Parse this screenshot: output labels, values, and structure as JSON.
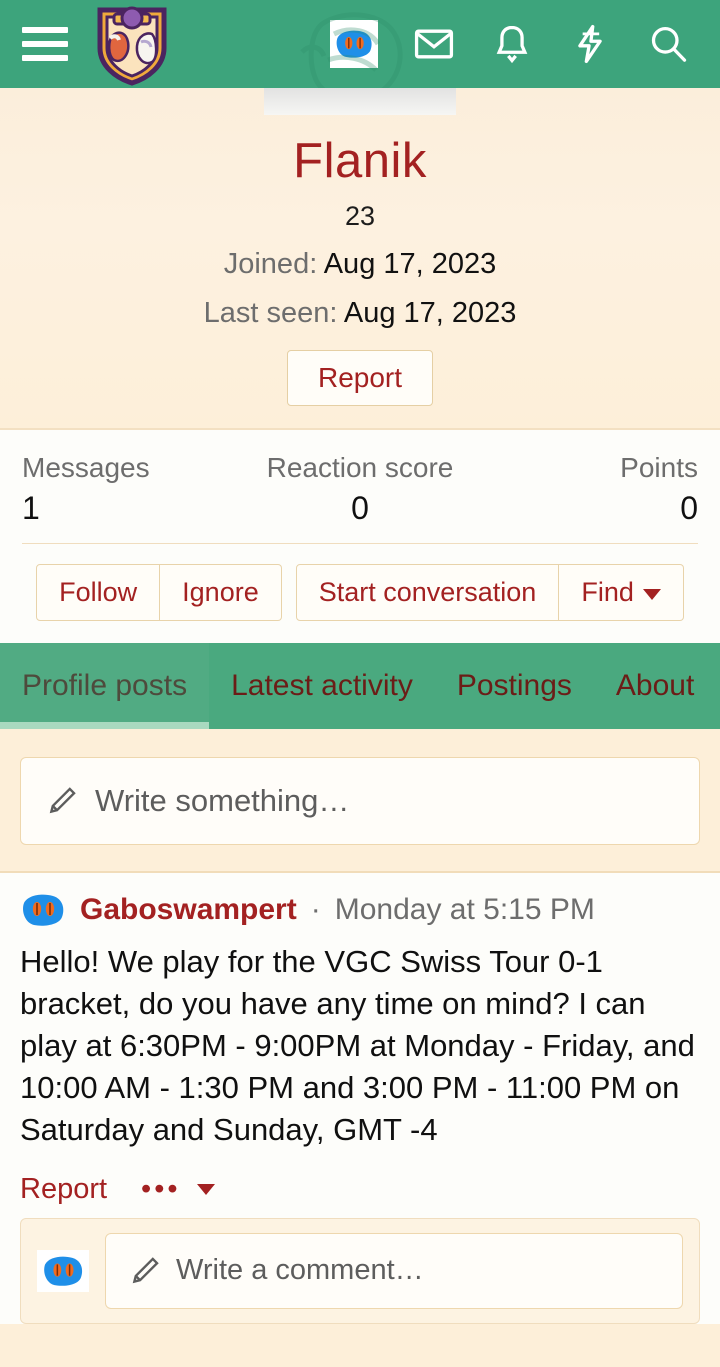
{
  "header": {
    "menu_icon": "hamburger-menu-icon",
    "logo_icon": "site-logo-crest-icon",
    "avatar_icon": "user-avatar-icon",
    "inbox_icon": "envelope-icon",
    "alerts_icon": "bell-icon",
    "whats_new_icon": "lightning-bolt-icon",
    "search_icon": "magnifier-icon",
    "brand_color": "#3da47c"
  },
  "profile": {
    "username": "Flanik",
    "user_title": "23",
    "joined_label": "Joined:",
    "joined_value": "Aug 17, 2023",
    "last_seen_label": "Last seen:",
    "last_seen_value": "Aug 17, 2023",
    "report_label": "Report",
    "username_color": "#a32121"
  },
  "stats": [
    {
      "label": "Messages",
      "value": "1"
    },
    {
      "label": "Reaction score",
      "value": "0"
    },
    {
      "label": "Points",
      "value": "0"
    }
  ],
  "actions": {
    "follow": "Follow",
    "ignore": "Ignore",
    "start_conversation": "Start conversation",
    "find": "Find"
  },
  "tabs": [
    {
      "label": "Profile posts",
      "active": true
    },
    {
      "label": "Latest activity",
      "active": false
    },
    {
      "label": "Postings",
      "active": false
    },
    {
      "label": "About",
      "active": false
    }
  ],
  "write": {
    "placeholder": "Write something…",
    "pencil_icon": "pencil-icon"
  },
  "post": {
    "author": "Gaboswampert",
    "separator": "·",
    "timestamp": "Monday at 5:15 PM",
    "body": "Hello! We play for the VGC Swiss Tour 0-1 bracket, do you have any time on mind? I can play at 6:30PM - 9:00PM at Monday - Friday, and 10:00 AM - 1:30 PM and 3:00 PM - 11:00 PM on Saturday and Sunday, GMT -4",
    "report_label": "Report",
    "more_label": "•••",
    "comment_placeholder": "Write a comment…",
    "avatar_icon": "user-avatar-icon"
  }
}
